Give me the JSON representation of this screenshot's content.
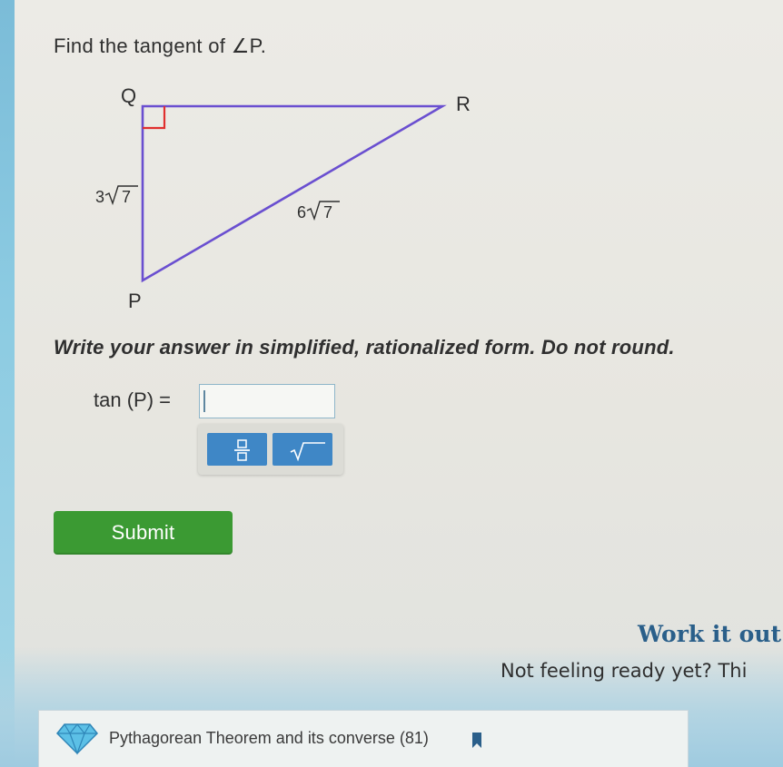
{
  "question": {
    "text": "Find the tangent of ∠P."
  },
  "figure": {
    "vertices": {
      "q": "Q",
      "r": "R",
      "p": "P"
    },
    "sides": {
      "qp_coefficient": "3",
      "qp_radicand": "7",
      "pr_coefficient": "6",
      "pr_radicand": "7"
    },
    "line_color": "#6a4fd0",
    "right_angle_color": "#e0302e"
  },
  "instruction": "Write your answer in simplified, rationalized form. Do not round.",
  "answer": {
    "label": "tan (P) =",
    "value": "",
    "palette": {
      "fraction_icon": "fraction-icon",
      "sqrt_icon": "square-root-icon"
    }
  },
  "submit_label": "Submit",
  "help": {
    "work_it_out": "Work it out",
    "not_ready": "Not feeling ready yet? Thi"
  },
  "skill": {
    "label": "Pythagorean Theorem and its converse (81)",
    "icon": "diamond-gem-icon",
    "bookmark_icon": "bookmark-icon"
  },
  "colors": {
    "submit_green": "#3b9a33",
    "palette_blue": "#3f87c6",
    "link_blue": "#2a5f8a"
  }
}
